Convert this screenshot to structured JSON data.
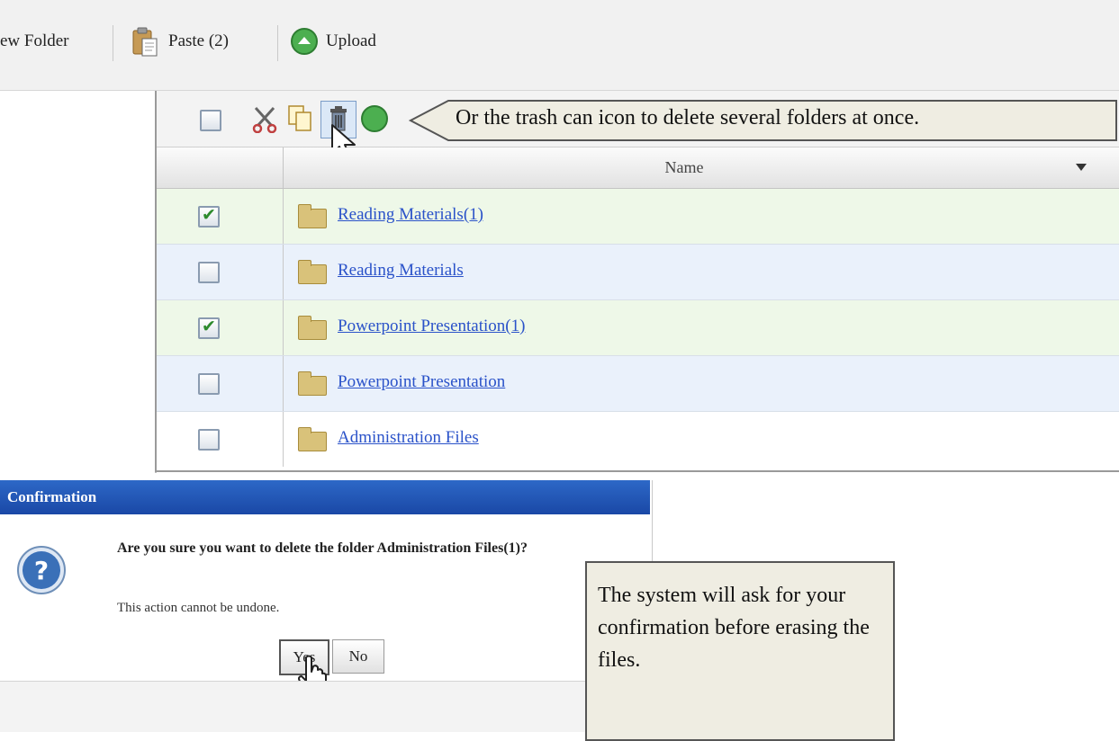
{
  "toolbar": {
    "new_folder_label": "ew Folder",
    "paste_label": "Paste (2)",
    "upload_label": "Upload"
  },
  "grid": {
    "column_header": "Name",
    "rows": [
      {
        "name": "Reading Materials(1)",
        "checked": true
      },
      {
        "name": "Reading Materials",
        "checked": false
      },
      {
        "name": "Powerpoint Presentation(1)",
        "checked": true
      },
      {
        "name": "Powerpoint Presentation",
        "checked": false
      },
      {
        "name": "Administration Files",
        "checked": false
      }
    ]
  },
  "callouts": {
    "trash_tip": "Or the trash can icon to delete several folders at once.",
    "confirm_tip": "The system will ask for your confirmation before erasing the files."
  },
  "dialog": {
    "title": "Confirmation",
    "message": "Are you sure you want to delete the folder Administration Files(1)?",
    "note": "This action cannot be undone.",
    "yes_label": "Yes",
    "no_label": "No"
  },
  "colors": {
    "row_checked": "#eef8e8",
    "row_alt": "#eaf1fb",
    "dialog_title_bg": "#1f52b3",
    "link": "#2a52c9"
  }
}
